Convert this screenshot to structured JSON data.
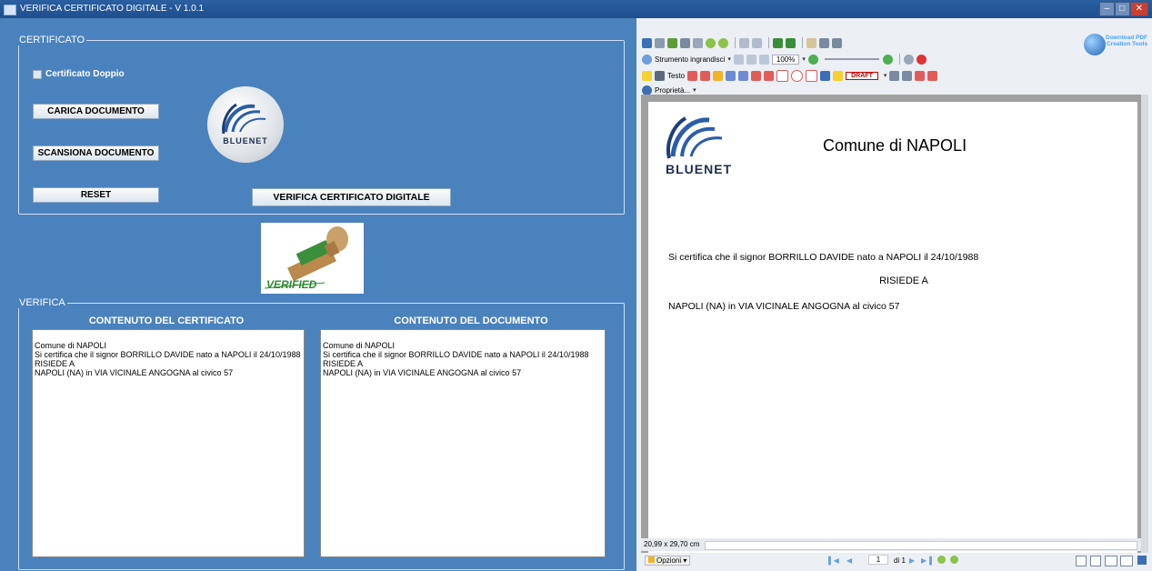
{
  "window": {
    "title": "VERIFICA CERTIFICATO DIGITALE  -  V 1.0.1",
    "min": "–",
    "max": "□",
    "close": "✕"
  },
  "certificato": {
    "legend": "CERTIFICATO",
    "checkbox_label": "Certificato Doppio",
    "carica": "CARICA DOCUMENTO",
    "scansiona": "SCANSIONA DOCUMENTO",
    "reset": "RESET",
    "verifica": "VERIFICA CERTIFICATO DIGITALE",
    "logo_text": "BLUENET"
  },
  "stamp": {
    "label": "VERIFIED"
  },
  "verifica": {
    "legend": "VERIFICA",
    "col1_title": "CONTENUTO DEL CERTIFICATO",
    "col2_title": "CONTENUTO DEL DOCUMENTO",
    "col1_lines": [
      "Comune di NAPOLI",
      "Si certifica che il signor BORRILLO DAVIDE nato a NAPOLI il 24/10/1988",
      "RISIEDE A",
      "NAPOLI (NA) in VIA VICINALE ANGOGNA al civico 57"
    ],
    "col2_lines": [
      "Comune di NAPOLI",
      "Si certifica che il signor BORRILLO DAVIDE nato a NAPOLI il 24/10/1988",
      "RISIEDE A",
      "NAPOLI (NA) in VIA VICINALE ANGOGNA al civico 57"
    ]
  },
  "pdf": {
    "toolbar": {
      "zoom_tool": "Strumento ingrandisci",
      "zoom_value": "100%",
      "text_tool": "Testo",
      "draft": "DRAFT",
      "properties": "Proprietà...",
      "download_badge": "Download PDF Creation Tools"
    },
    "page": {
      "logo_text": "BLUENET",
      "title": "Comune di NAPOLI",
      "line1": "Si certifica che il signor BORRILLO DAVIDE nato a NAPOLI il 24/10/1988",
      "line2": "RISIEDE A",
      "line3": "NAPOLI (NA) in VIA VICINALE ANGOGNA  al civico 57"
    },
    "status": {
      "size": "20,99 x 29,70 cm"
    },
    "nav": {
      "options": "Opzioni",
      "page_num": "1",
      "page_of": "di 1"
    }
  },
  "colors": {
    "background": "#4a82bd",
    "titlebar": "#1e4f8e",
    "page": "#ffffff"
  },
  "icons": [
    "save-icon",
    "print-icon",
    "zoom-icon",
    "text-icon",
    "stamp-icon",
    "options-icon",
    "prev-page-icon",
    "next-page-icon"
  ]
}
